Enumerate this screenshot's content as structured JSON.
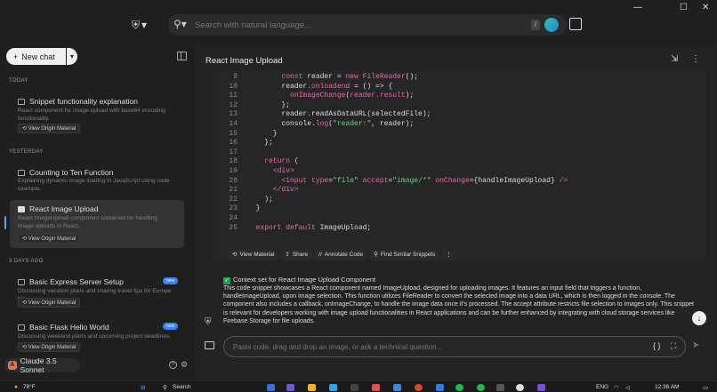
{
  "topbar": {
    "search_placeholder": "Search with natural language...",
    "slash_key": "/"
  },
  "window_controls": {
    "minimize": "—",
    "maximize": "☐",
    "close": "✕"
  },
  "sidebar": {
    "new_chat_label": "New chat",
    "sections": {
      "today": "TODAY",
      "yesterday": "YESTERDAY",
      "three_days_ago": "3 DAYS AGO"
    },
    "items": [
      {
        "title": "Snippet functionality explanation",
        "desc": "React component for image upload with base64 encoding functionality.",
        "button": "View Origin Material"
      },
      {
        "title": "Counting to Ten Function",
        "desc": "Explaining dynamic image loading in JavaScript using code example.",
        "button": ""
      },
      {
        "title": "React Image Upload",
        "desc": "React ImageUpload component explained for handling image uploads in React.",
        "button": "View Origin Material"
      },
      {
        "title": "Basic Express Server Setup",
        "desc": "Discussing vacation plans and sharing travel tips for Europe trip.",
        "button": "View Origin Material",
        "badge": "new"
      },
      {
        "title": "Basic Flask Hello World",
        "desc": "Discussing weekend plans and upcoming project deadlines.",
        "button": "View Origin Material",
        "badge": "new"
      }
    ],
    "model": "Claude 3.5 Sonnet",
    "model_initial": "A",
    "help": "?"
  },
  "main": {
    "title": "React Image Upload",
    "code_lines": [
      {
        "n": "9",
        "parts": [
          [
            "pu",
            "        "
          ],
          [
            "kw",
            "const"
          ],
          [
            "pu",
            " reader = "
          ],
          [
            "kw",
            "new"
          ],
          [
            "fn",
            " FileReader"
          ],
          [
            "pu",
            "();"
          ]
        ]
      },
      {
        "n": "10",
        "parts": [
          [
            "pu",
            "        reader."
          ],
          [
            "fn",
            "onloadend"
          ],
          [
            "pu",
            " = () => {"
          ]
        ]
      },
      {
        "n": "11",
        "parts": [
          [
            "pu",
            "          "
          ],
          [
            "fn",
            "onImageChange"
          ],
          [
            "pu",
            "("
          ],
          [
            "fn",
            "reader.result"
          ],
          [
            "pu",
            ");"
          ]
        ]
      },
      {
        "n": "12",
        "parts": [
          [
            "pu",
            "        };"
          ]
        ]
      },
      {
        "n": "13",
        "parts": [
          [
            "pu",
            "        reader.readAsDataURL(selectedFile);"
          ]
        ]
      },
      {
        "n": "14",
        "parts": [
          [
            "pu",
            "        console."
          ],
          [
            "fn",
            "log"
          ],
          [
            "pu",
            "("
          ],
          [
            "str",
            "\"reader:\""
          ],
          [
            "pu",
            ", reader);"
          ]
        ]
      },
      {
        "n": "15",
        "parts": [
          [
            "pu",
            "      }"
          ]
        ]
      },
      {
        "n": "16",
        "parts": [
          [
            "pu",
            "    };"
          ]
        ]
      },
      {
        "n": "17",
        "parts": [
          [
            "pu",
            ""
          ]
        ]
      },
      {
        "n": "18",
        "parts": [
          [
            "pu",
            "    "
          ],
          [
            "kw",
            "return"
          ],
          [
            "pu",
            " ("
          ]
        ]
      },
      {
        "n": "19",
        "parts": [
          [
            "pu",
            "      "
          ],
          [
            "kw",
            "<div>"
          ]
        ]
      },
      {
        "n": "20",
        "parts": [
          [
            "pu",
            "        "
          ],
          [
            "kw",
            "<input"
          ],
          [
            "pu",
            " "
          ],
          [
            "fn",
            "type"
          ],
          [
            "pu",
            "="
          ],
          [
            "str",
            "\"file\""
          ],
          [
            "pu",
            " "
          ],
          [
            "fn",
            "accept"
          ],
          [
            "pu",
            "="
          ],
          [
            "str",
            "\"image/*\""
          ],
          [
            "pu",
            " "
          ],
          [
            "fn",
            "onChange"
          ],
          [
            "pu",
            "={handleImageUpload} "
          ],
          [
            "kw",
            "/>"
          ]
        ]
      },
      {
        "n": "21",
        "parts": [
          [
            "pu",
            "      "
          ],
          [
            "kw",
            "</div>"
          ]
        ]
      },
      {
        "n": "22",
        "parts": [
          [
            "pu",
            "    );"
          ]
        ]
      },
      {
        "n": "23",
        "parts": [
          [
            "pu",
            "  }"
          ]
        ]
      },
      {
        "n": "24",
        "parts": [
          [
            "pu",
            ""
          ]
        ]
      },
      {
        "n": "25",
        "parts": [
          [
            "kw",
            "  export default"
          ],
          [
            "pu",
            " ImageUpload;"
          ]
        ]
      }
    ],
    "actions": [
      "View Material",
      "Share",
      "Annotate Code",
      "Find Similar Snippets"
    ],
    "context_head": "Context set for React Image Upload Component",
    "context_body": "This code snippet showcases a React component named ImageUpload, designed for uploading images. It features an input field that triggers a function, handleImageUpload, upon image selection. This function utilizes FileReader to convert the selected image into a data URL, which is then logged in the console. The component also includes a callback, onImageChange, to handle the image data once it's processed. The accept attribute restricts file selection to images only. This snippet is relevant for developers working with image upload functionalities in React applications and can be further enhanced by integrating with cloud storage services like Firebase Storage for file uploads.",
    "input_placeholder": "Paste code, drag and drop an image, or ask a technical question..."
  },
  "taskbar": {
    "weather": "78°F",
    "search": "Search",
    "lang": "ENG",
    "time": "12:36 AM"
  }
}
